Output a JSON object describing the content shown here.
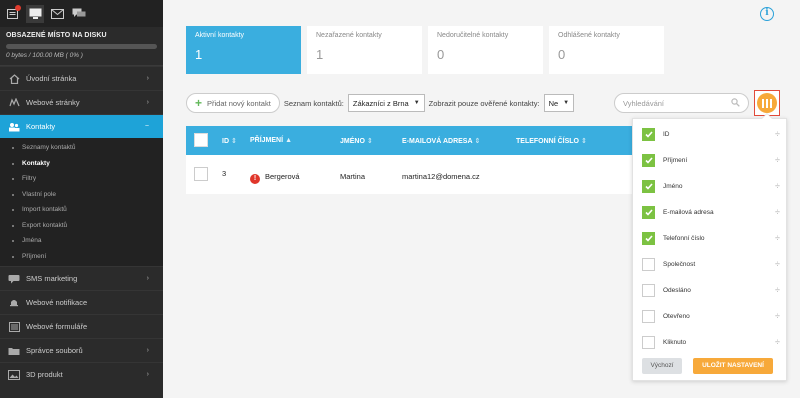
{
  "sidebar": {
    "disk": {
      "title": "OBSAZENÉ MÍSTO NA DISKU",
      "value": "0 bytes / 100.00 MB ( 0% )",
      "usage_percent": 0
    },
    "menu_top": [
      {
        "label": "Úvodní stránka",
        "icon": "home-icon"
      },
      {
        "label": "Webové stránky",
        "icon": "globe-icon"
      }
    ],
    "active": {
      "label": "Kontakty",
      "icon": "users-icon",
      "arrow": "−"
    },
    "submenu": [
      {
        "label": "Seznamy kontaktů"
      },
      {
        "label": "Kontakty"
      },
      {
        "label": "Filtry"
      },
      {
        "label": "Vlastní pole"
      },
      {
        "label": "Import kontaktů"
      },
      {
        "label": "Export kontaktů"
      },
      {
        "label": "Jména"
      },
      {
        "label": "Příjmení"
      }
    ],
    "menu_bottom": [
      {
        "label": "SMS marketing",
        "icon": "sms-icon",
        "arrow": "›"
      },
      {
        "label": "Webové notifikace",
        "icon": "bell-icon",
        "arrow": ""
      },
      {
        "label": "Webové formuláře",
        "icon": "form-icon",
        "arrow": ""
      },
      {
        "label": "Správce souborů",
        "icon": "folder-icon",
        "arrow": "›"
      },
      {
        "label": "3D produkt",
        "icon": "image-icon",
        "arrow": "›"
      }
    ],
    "arrow": "›"
  },
  "tabs": [
    {
      "label": "Aktivní kontakty",
      "count": "1"
    },
    {
      "label": "Nezařazené kontakty",
      "count": "1"
    },
    {
      "label": "Nedoručitelné kontakty",
      "count": "0"
    },
    {
      "label": "Odhlášené kontakty",
      "count": "0"
    }
  ],
  "toolbar": {
    "add_label": "Přidat nový kontakt",
    "list_label": "Seznam kontaktů:",
    "list_value": "Zákazníci z Brna",
    "verified_label": "Zobrazit pouze ověřené kontakty:",
    "verified_value": "Ne",
    "caret": "▼"
  },
  "search": {
    "placeholder": "Vyhledávání"
  },
  "table": {
    "columns": [
      {
        "label": "ID",
        "sort": "⇕"
      },
      {
        "label": "PŘÍJMENÍ",
        "sort": "▲"
      },
      {
        "label": "JMÉNO",
        "sort": "⇕"
      },
      {
        "label": "E-MAILOVÁ ADRESA",
        "sort": "⇕"
      },
      {
        "label": "TELEFONNÍ ČÍSLO",
        "sort": "⇕"
      }
    ],
    "rows": [
      {
        "id": "3",
        "warning": "!",
        "surname": "Bergerová",
        "name": "Martina",
        "email": "martina12@domena.cz",
        "phone": ""
      }
    ]
  },
  "column_picker": {
    "items": [
      {
        "label": "ID",
        "checked": true
      },
      {
        "label": "Příjmení",
        "checked": true
      },
      {
        "label": "Jméno",
        "checked": true
      },
      {
        "label": "E-mailová adresa",
        "checked": true
      },
      {
        "label": "Telefonní číslo",
        "checked": true
      },
      {
        "label": "Společnost",
        "checked": false
      },
      {
        "label": "Odesláno",
        "checked": false
      },
      {
        "label": "Otevřeno",
        "checked": false
      },
      {
        "label": "Kliknuto",
        "checked": false
      }
    ],
    "drag_glyph": "÷",
    "default_label": "Výchozí",
    "save_label": "ULOŽIT NASTAVENÍ"
  },
  "info_glyph": "i",
  "colors": {
    "accent": "#3aaedf",
    "orange": "#f7a93a",
    "green": "#7cc242",
    "sidebar": "#2b2b2b"
  }
}
